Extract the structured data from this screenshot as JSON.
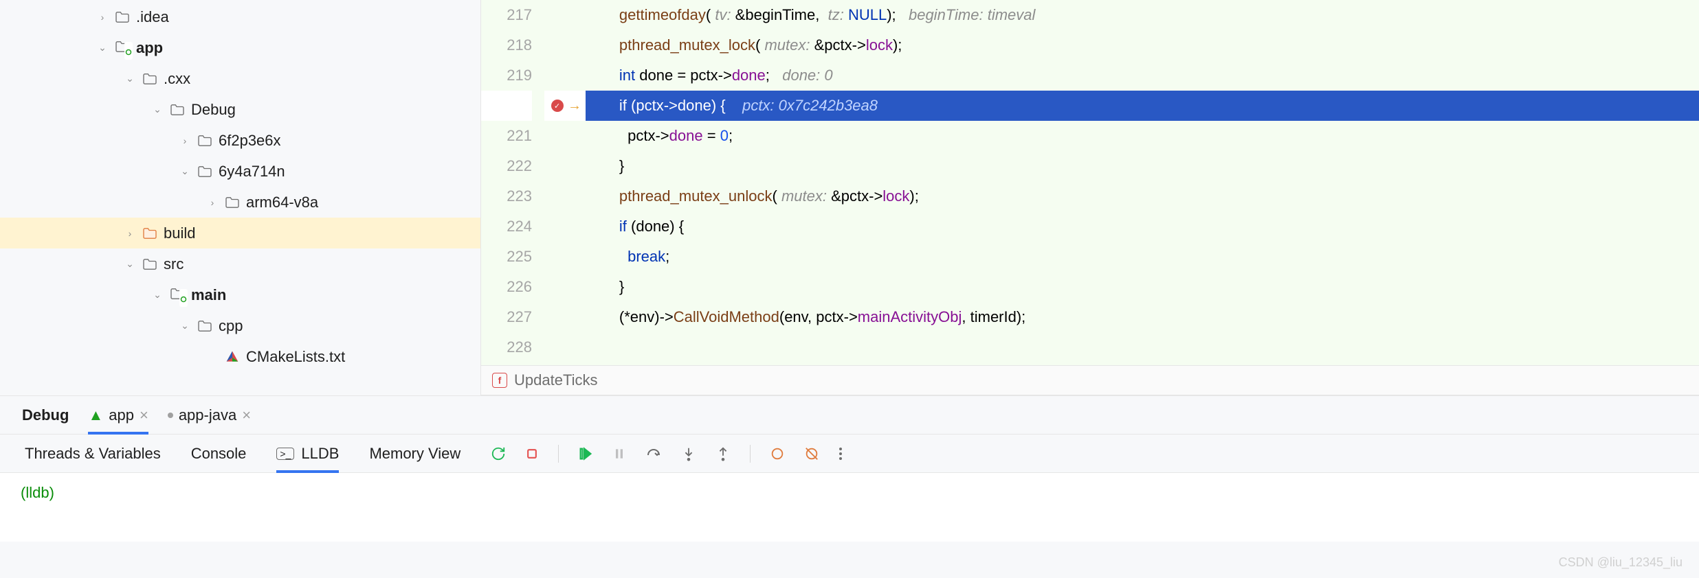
{
  "tree": [
    {
      "indent": 140,
      "chev": ">",
      "icon": "folder",
      "label": ".idea"
    },
    {
      "indent": 140,
      "chev": "v",
      "icon": "folder-green",
      "label": "app",
      "bold": true
    },
    {
      "indent": 180,
      "chev": "v",
      "icon": "folder",
      "label": ".cxx"
    },
    {
      "indent": 220,
      "chev": "v",
      "icon": "folder",
      "label": "Debug"
    },
    {
      "indent": 260,
      "chev": ">",
      "icon": "folder",
      "label": "6f2p3e6x"
    },
    {
      "indent": 260,
      "chev": "v",
      "icon": "folder",
      "label": "6y4a714n"
    },
    {
      "indent": 300,
      "chev": ">",
      "icon": "folder",
      "label": "arm64-v8a"
    },
    {
      "indent": 180,
      "chev": ">",
      "icon": "folder-orange",
      "label": "build",
      "hl": true
    },
    {
      "indent": 180,
      "chev": "v",
      "icon": "folder",
      "label": "src"
    },
    {
      "indent": 220,
      "chev": "v",
      "icon": "folder-green",
      "label": "main",
      "bold": true
    },
    {
      "indent": 260,
      "chev": "v",
      "icon": "folder",
      "label": "cpp"
    },
    {
      "indent": 300,
      "chev": "",
      "icon": "cmake",
      "label": "CMakeLists.txt"
    }
  ],
  "code": {
    "start": 217,
    "current": 220,
    "lines": [
      {
        "seg": [
          [
            "",
            "        "
          ],
          [
            "fn",
            "gettimeofday"
          ],
          [
            "",
            "( "
          ],
          [
            "hint",
            "tv: "
          ],
          [
            "",
            "&beginTime,  "
          ],
          [
            "hint",
            "tz: "
          ],
          [
            "kw",
            "NULL"
          ],
          [
            "",
            ");   "
          ],
          [
            "hint",
            "beginTime: timeval"
          ]
        ]
      },
      {
        "seg": [
          [
            "",
            "        "
          ],
          [
            "fn",
            "pthread_mutex_lock"
          ],
          [
            "",
            "( "
          ],
          [
            "hint",
            "mutex: "
          ],
          [
            "",
            "&pctx->"
          ],
          [
            "mem",
            "lock"
          ],
          [
            "",
            ");"
          ]
        ]
      },
      {
        "seg": [
          [
            "",
            "        "
          ],
          [
            "kw",
            "int"
          ],
          [
            "",
            " done = pctx->"
          ],
          [
            "mem",
            "done"
          ],
          [
            "",
            ";   "
          ],
          [
            "hint",
            "done: 0"
          ]
        ]
      },
      {
        "cur": true,
        "seg": [
          [
            "",
            "        "
          ],
          [
            "kw",
            "if"
          ],
          [
            "",
            " (pctx->"
          ],
          [
            "mem",
            "done"
          ],
          [
            "",
            ") {    "
          ],
          [
            "hint",
            "pctx: 0x7c242b3ea8"
          ]
        ]
      },
      {
        "seg": [
          [
            "",
            "          pctx->"
          ],
          [
            "mem",
            "done"
          ],
          [
            "",
            " = "
          ],
          [
            "num",
            "0"
          ],
          [
            "",
            ";"
          ]
        ]
      },
      {
        "seg": [
          [
            "",
            "        }"
          ]
        ]
      },
      {
        "seg": [
          [
            "",
            "        "
          ],
          [
            "fn",
            "pthread_mutex_unlock"
          ],
          [
            "",
            "( "
          ],
          [
            "hint",
            "mutex: "
          ],
          [
            "",
            "&pctx->"
          ],
          [
            "mem",
            "lock"
          ],
          [
            "",
            ");"
          ]
        ]
      },
      {
        "seg": [
          [
            "",
            "        "
          ],
          [
            "kw",
            "if"
          ],
          [
            "",
            " (done) {"
          ]
        ]
      },
      {
        "seg": [
          [
            "",
            "          "
          ],
          [
            "kw",
            "break"
          ],
          [
            "",
            ";"
          ]
        ]
      },
      {
        "seg": [
          [
            "",
            "        }"
          ]
        ]
      },
      {
        "seg": [
          [
            "",
            "        (*env)->"
          ],
          [
            "fn",
            "CallVoidMethod"
          ],
          [
            "",
            "(env, pctx->"
          ],
          [
            "mem",
            "mainActivityObj"
          ],
          [
            "",
            ", timerId);"
          ]
        ]
      },
      {
        "seg": [
          [
            "",
            ""
          ]
        ]
      }
    ]
  },
  "crumb": "UpdateTicks",
  "debug": {
    "title": "Debug",
    "tabs": [
      {
        "name": "app",
        "icon": "android",
        "on": true
      },
      {
        "name": "app-java",
        "icon": "dot-gray"
      }
    ],
    "tools": [
      {
        "label": "Threads & Variables"
      },
      {
        "label": "Console"
      },
      {
        "label": "LLDB",
        "icon": "terminal",
        "on": true
      },
      {
        "label": "Memory View"
      }
    ],
    "console": "(lldb)"
  },
  "watermark": "CSDN @liu_12345_liu"
}
